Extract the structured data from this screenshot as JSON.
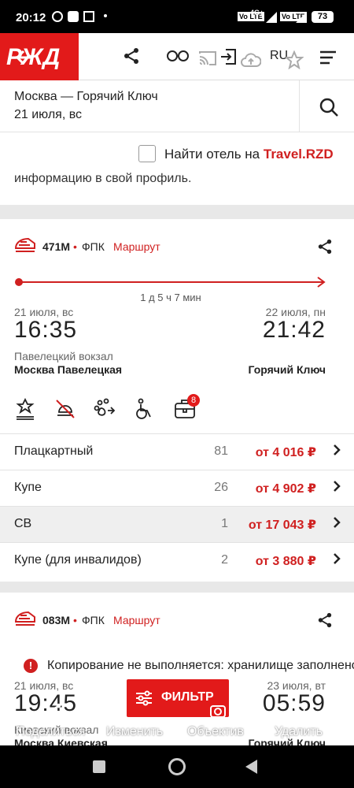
{
  "status": {
    "time": "20:12",
    "battery": "73",
    "network": "4G+"
  },
  "appbar": {
    "lang": "RU"
  },
  "search": {
    "route": "Москва — Горячий Ключ",
    "date": "21 июля, вс"
  },
  "hotel": {
    "prefix": "Найти отель на ",
    "brand": "Travel.RZD",
    "clipped_text": "информацию в свой профиль."
  },
  "train1": {
    "number": "471М",
    "sep": "•",
    "carrier": "ФПК",
    "route_link": "Маршрут",
    "duration": "1 д 5 ч 7 мин",
    "dep_date": "21 июля, вс",
    "dep_time": "16:35",
    "arr_date": "22 июля, пн",
    "arr_time": "21:42",
    "dep_station_label": "Павелецкий вокзал",
    "dep_city": "Москва Павелецкая",
    "arr_city": "Горячий Ключ",
    "badge_count": "8",
    "classes": [
      {
        "name": "Плацкартный",
        "count": "81",
        "price": "от 4 016 ₽"
      },
      {
        "name": "Купе",
        "count": "26",
        "price": "от 4 902 ₽"
      },
      {
        "name": "СВ",
        "count": "1",
        "price": "от 17 043 ₽"
      },
      {
        "name": "Купе (для инвалидов)",
        "count": "2",
        "price": "от 3 880 ₽"
      }
    ]
  },
  "train2": {
    "number": "083М",
    "sep": "•",
    "carrier": "ФПК",
    "route_link": "Маршрут",
    "dep_date": "21 июля, вс",
    "dep_time": "19:45",
    "arr_date": "23 июля, вт",
    "arr_time": "05:59",
    "dep_station_label": "Киевский вокзал",
    "dep_city": "Москва Киевская",
    "arr_city": "Горячий Ключ"
  },
  "toast": {
    "text": "Копирование не выполняется: хранилище заполнено"
  },
  "filter": {
    "label": "ФИЛЬТР"
  },
  "screenshot_actions": {
    "share": "Поделиться",
    "edit": "Изменить",
    "lens": "Объектив",
    "delete": "Удалить"
  },
  "colors": {
    "brand_red": "#e21a1a",
    "price_red": "#d02020"
  }
}
